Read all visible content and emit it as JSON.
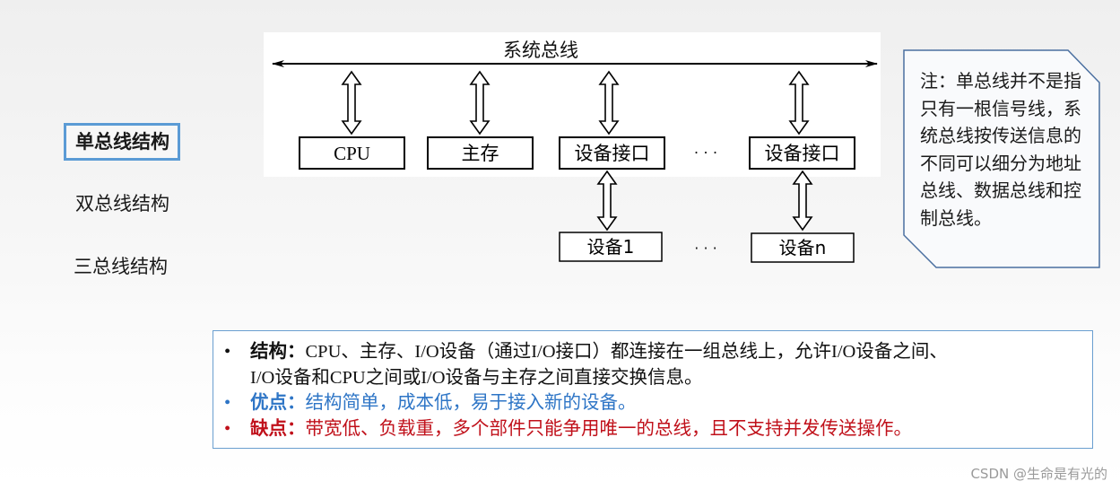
{
  "nav": {
    "items": [
      {
        "label": "单总线结构",
        "active": true
      },
      {
        "label": "双总线结构",
        "active": false
      },
      {
        "label": "三总线结构",
        "active": false
      }
    ]
  },
  "diagram": {
    "bus_label": "系统总线",
    "top_boxes": [
      "CPU",
      "主存",
      "设备接口",
      "设备接口"
    ],
    "top_ellipsis": "· · ·",
    "bottom_boxes": [
      "设备1",
      "设备n"
    ],
    "bottom_ellipsis": "· · ·",
    "stroke_color": "#000000"
  },
  "note": {
    "text": "注：单总线并不是指只有一根信号线，系统总线按传送信息的不同可以细分为地址总线、数据总线和控制总线。",
    "border_color": "#4a6fa0"
  },
  "summary": {
    "bullet": "•",
    "structure": {
      "label": "结构：",
      "line1": "CPU、主存、I/O设备（通过I/O接口）都连接在一组总线上，允许I/O设备之间、",
      "line2": "I/O设备和CPU之间或I/O设备与主存之间直接交换信息。"
    },
    "pros": {
      "label": "优点：",
      "text": "结构简单，成本低，易于接入新的设备。",
      "color": "#2e75c6"
    },
    "cons": {
      "label": "缺点：",
      "text": "带宽低、负载重，多个部件只能争用唯一的总线，且不支持并发传送操作。",
      "color": "#c0101a"
    }
  },
  "watermark": "CSDN @生命是有光的"
}
